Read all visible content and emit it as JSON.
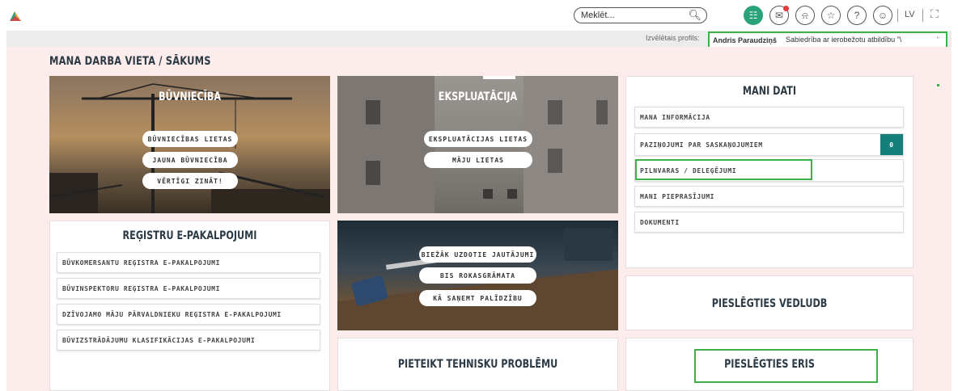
{
  "header": {
    "search_placeholder": "Meklēt...",
    "lang": "LV",
    "icons": [
      "apps-icon",
      "mail-alert-icon",
      "bell-icon",
      "star-icon",
      "help-icon",
      "user-icon",
      "fullscreen-icon"
    ],
    "accent_color": "#2aa37c"
  },
  "profile": {
    "label": "Izvēlētais profils:",
    "name": "Andris Paraudziņš",
    "org": "Sabiedrība ar ierobežotu atbildību \"\\",
    "caret": "\""
  },
  "breadcrumb": "MANA DARBA VIETA / SĀKUMS",
  "tiles": {
    "buvnieciba": {
      "title": "BŪVNIECĪBA",
      "buttons": [
        "BŪVNIECĪBAS LIETAS",
        "JAUNA BŪVNIECĪBA",
        "VĒRTĪGI ZINĀT!"
      ]
    },
    "ekspluatacija": {
      "title": "EKSPLUATĀCIJA",
      "buttons": [
        "EKSPLUATĀCIJAS LIETAS",
        "MĀJU LIETAS"
      ]
    },
    "faq": {
      "buttons": [
        "BIEŽĀK UZDOTIE JAUTĀJUMI",
        "BIS ROKASGRĀMATA",
        "KĀ SAŅEMT PALĪDZĪBU"
      ]
    }
  },
  "registri": {
    "title": "REĢISTRU E-PAKALPOJUMI",
    "items": [
      "BŪVKOMERSANTU REĢISTRA E-PAKALPOJUMI",
      "BŪVINSPEKTORU REĢISTRA E-PAKALPOJUMI",
      "DZĪVOJAMO MĀJU PĀRVALDNIEKU REĢISTRA E-PAKALPOJUMI",
      "BŪVIZSTRĀDĀJUMU KLASIFIKĀCIJAS E-PAKALPOJUMI"
    ]
  },
  "mani_dati": {
    "title": "MANI DATI",
    "items": [
      "MANA INFORMĀCIJA",
      "PAZIŅOJUMI PAR SASKAŅOJUMIEM",
      "PILNVARAS / DELEĢĒJUMI",
      "MANI PIEPRASĪJUMI",
      "DOKUMENTI"
    ],
    "notif_count": "0"
  },
  "actions": {
    "tehn": "PIETEIKT TEHNISKU PROBLĒMU",
    "vedludb": "PIESLĒGTIES VEDLUDB",
    "eris": "PIESLĒGTIES ERIS"
  }
}
